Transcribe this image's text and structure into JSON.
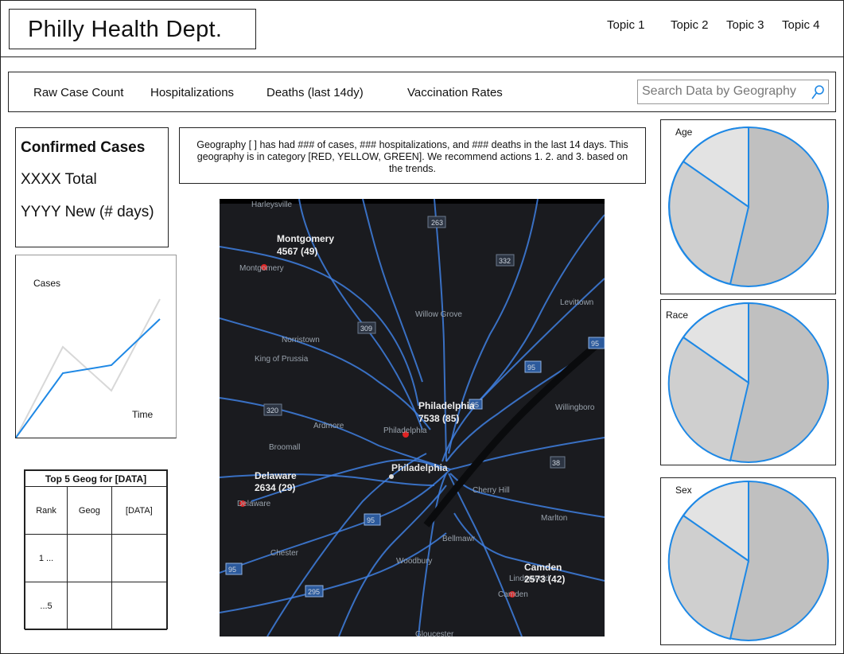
{
  "header": {
    "brand": "Philly Health Dept.",
    "topics": [
      "Topic 1",
      "Topic 2",
      "Topic 3",
      "Topic 4"
    ]
  },
  "nav": {
    "links": [
      "Raw Case Count",
      "Hospitalizations",
      "Deaths (last 14dy)",
      "Vaccination Rates"
    ],
    "search_placeholder": "Search Data by Geography",
    "search_icon": "search-icon"
  },
  "confirmed": {
    "title": "Confirmed Cases",
    "total": "XXXX Total",
    "new": "YYYY New (# days)"
  },
  "cases_chart": {
    "ylabel": "Cases",
    "xlabel": "Time"
  },
  "summary": {
    "text": "Geography [ ] has had ### of cases, ### hospitalizations, and ### deaths in the last 14 days. This geography is in category [RED, YELLOW, GREEN]. We recommend actions 1. 2. and 3. based on the trends."
  },
  "top5": {
    "caption": "Top 5 Geog for [DATA]",
    "headers": [
      "Rank",
      "Geog",
      "[DATA]"
    ],
    "rows": [
      [
        "1 ...",
        "",
        ""
      ],
      [
        "...5",
        "",
        ""
      ]
    ]
  },
  "map": {
    "markers": [
      {
        "name": "Montgomery",
        "value": "4567 (49)"
      },
      {
        "name": "Philadelphia",
        "value": "7538 (85)"
      },
      {
        "name": "Delaware",
        "value": "2634 (29)"
      },
      {
        "name": "Camden",
        "value": "2573 (42)"
      }
    ],
    "place_labels": [
      "Harleysville",
      "Montgomery",
      "Norristown",
      "King of Prussia",
      "Willow Grove",
      "Levittown",
      "Ardmore",
      "Broomall",
      "Philadelphia",
      "Cherry Hill",
      "Willingboro",
      "Marlton",
      "Bellmawr",
      "Woodbury",
      "Chester",
      "Lindenwold",
      "Camden",
      "Delaware",
      "Gloucester"
    ],
    "road_shields": [
      "263",
      "332",
      "309",
      "95",
      "95",
      "320",
      "95",
      "38",
      "95",
      "295",
      "95"
    ],
    "colors": {
      "background": "#1a1b1f",
      "road": "#3f7fe0",
      "marker": "#e02424"
    }
  },
  "pies": [
    {
      "label": "Age"
    },
    {
      "label": "Race"
    },
    {
      "label": "Sex"
    }
  ],
  "colors": {
    "accent": "#1e88e5",
    "pie_dark": "#c0c0c0",
    "pie_mid": "#cfcfcf",
    "pie_light": "#e3e3e3",
    "chart_gray": "#d8d8d8"
  }
}
